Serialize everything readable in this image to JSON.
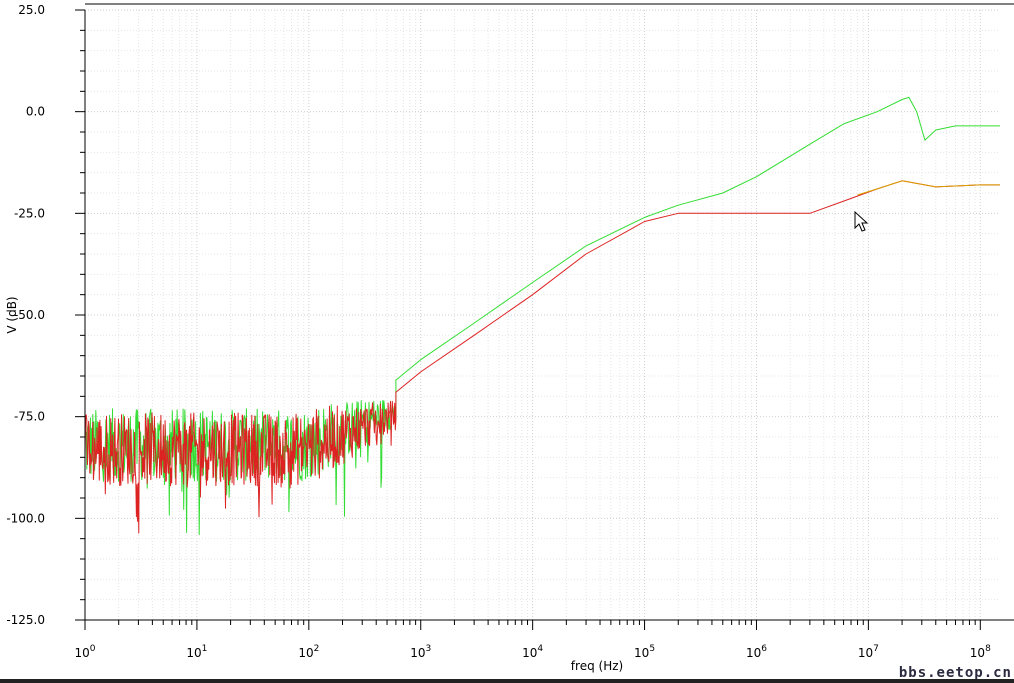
{
  "chart_data": {
    "type": "line",
    "xlabel": "freq (Hz)",
    "ylabel": "V (dB)",
    "x_scale": "log",
    "xlim": [
      1,
      150000000
    ],
    "ylim": [
      -125,
      25
    ],
    "grid": true,
    "y_ticks": [
      25,
      0,
      -25,
      -50,
      -75,
      -100,
      -125
    ],
    "y_tick_labels": [
      "25.0",
      "0.0",
      "-25.0",
      "-50.0",
      "-75.0",
      "-100.0",
      "-125.0"
    ],
    "x_ticks": [
      {
        "base": "10",
        "exp": "0",
        "value": 1
      },
      {
        "base": "10",
        "exp": "1",
        "value": 10
      },
      {
        "base": "10",
        "exp": "2",
        "value": 100
      },
      {
        "base": "10",
        "exp": "3",
        "value": 1000
      },
      {
        "base": "10",
        "exp": "4",
        "value": 10000
      },
      {
        "base": "10",
        "exp": "5",
        "value": 100000
      },
      {
        "base": "10",
        "exp": "6",
        "value": 1000000
      },
      {
        "base": "10",
        "exp": "7",
        "value": 10000000
      },
      {
        "base": "10",
        "exp": "8",
        "value": 100000000
      }
    ],
    "series": [
      {
        "color": "#33dd33",
        "noise": {
          "x_start": 1,
          "x_end": 600,
          "base": -82,
          "amp": 9
        },
        "values": [
          {
            "x": 600,
            "y": -66
          },
          {
            "x": 1000,
            "y": -61
          },
          {
            "x": 3000,
            "y": -52
          },
          {
            "x": 10000,
            "y": -42
          },
          {
            "x": 30000,
            "y": -33
          },
          {
            "x": 100000,
            "y": -26
          },
          {
            "x": 200000,
            "y": -23
          },
          {
            "x": 500000,
            "y": -20
          },
          {
            "x": 1000000,
            "y": -16
          },
          {
            "x": 3000000,
            "y": -8
          },
          {
            "x": 6000000,
            "y": -3
          },
          {
            "x": 12000000,
            "y": 0
          },
          {
            "x": 20000000,
            "y": 3
          },
          {
            "x": 23000000,
            "y": 3.5
          },
          {
            "x": 27000000,
            "y": 0
          },
          {
            "x": 32000000,
            "y": -7
          },
          {
            "x": 40000000,
            "y": -4.5
          },
          {
            "x": 60000000,
            "y": -3.5
          },
          {
            "x": 100000000,
            "y": -3.5
          },
          {
            "x": 150000000,
            "y": -3.5
          }
        ]
      },
      {
        "color": "#dd2222",
        "noise": {
          "x_start": 1,
          "x_end": 600,
          "base": -83,
          "amp": 9
        },
        "values": [
          {
            "x": 600,
            "y": -69
          },
          {
            "x": 1000,
            "y": -64
          },
          {
            "x": 3000,
            "y": -55
          },
          {
            "x": 10000,
            "y": -45
          },
          {
            "x": 30000,
            "y": -35
          },
          {
            "x": 100000,
            "y": -27
          },
          {
            "x": 200000,
            "y": -25
          },
          {
            "x": 500000,
            "y": -25
          },
          {
            "x": 1000000,
            "y": -25
          },
          {
            "x": 3000000,
            "y": -25
          },
          {
            "x": 6000000,
            "y": -22
          },
          {
            "x": 12000000,
            "y": -19
          },
          {
            "x": 20000000,
            "y": -17
          },
          {
            "x": 40000000,
            "y": -18.5
          },
          {
            "x": 100000000,
            "y": -18
          },
          {
            "x": 150000000,
            "y": -18
          }
        ]
      },
      {
        "color": "#d9a000",
        "values": [
          {
            "x": 8000000,
            "y": -20.5
          },
          {
            "x": 12000000,
            "y": -19
          },
          {
            "x": 20000000,
            "y": -17
          },
          {
            "x": 40000000,
            "y": -18.5
          },
          {
            "x": 100000000,
            "y": -18
          },
          {
            "x": 150000000,
            "y": -18
          }
        ]
      }
    ]
  },
  "watermark": "bbs.eetop.cn"
}
